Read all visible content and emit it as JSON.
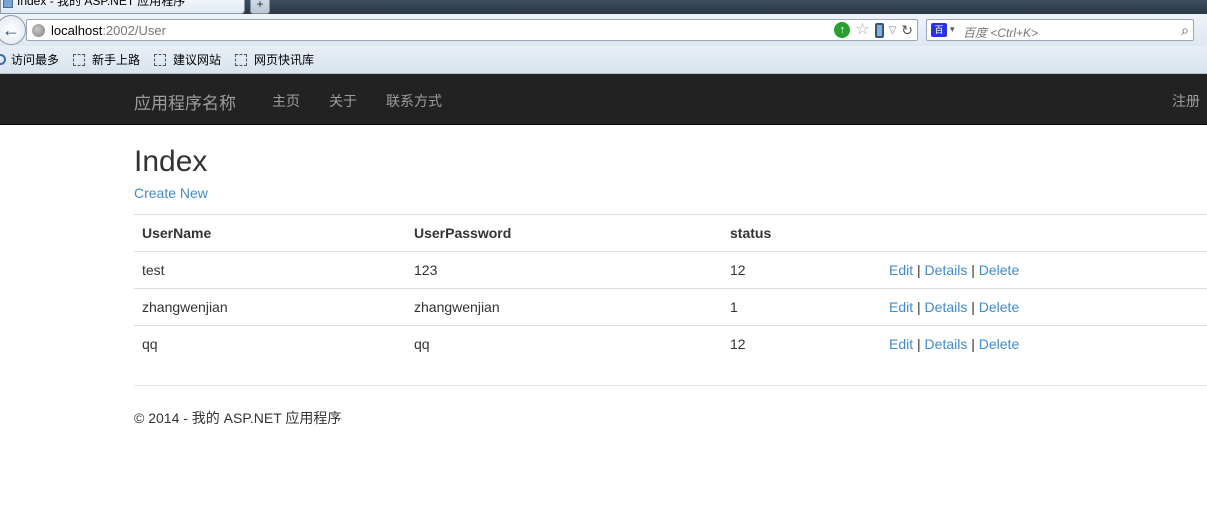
{
  "browser": {
    "tab_title": "Index - 我的 ASP.NET 应用程序",
    "new_tab_label": "+",
    "url_host": "localhost",
    "url_path": ":2002/User",
    "search_placeholder": "百度 <Ctrl+K>",
    "search_engine_label": "百",
    "bookmarks": [
      "访问最多",
      "新手上路",
      "建议网站",
      "网页快讯库"
    ]
  },
  "navbar": {
    "brand": "应用程序名称",
    "links": [
      "主页",
      "关于",
      "联系方式"
    ],
    "register": "注册"
  },
  "main": {
    "title": "Index",
    "create_link": "Create New",
    "table": {
      "headers": [
        "UserName",
        "UserPassword",
        "status"
      ],
      "rows": [
        {
          "username": "test",
          "password": "123",
          "status": "12"
        },
        {
          "username": "zhangwenjian",
          "password": "zhangwenjian",
          "status": "1"
        },
        {
          "username": "qq",
          "password": "qq",
          "status": "12"
        }
      ],
      "actions": {
        "edit": "Edit",
        "details": "Details",
        "delete": "Delete",
        "separator": "|"
      }
    }
  },
  "footer": {
    "text": "© 2014 - 我的 ASP.NET 应用程序"
  },
  "colors": {
    "navbar_bg": "#222222",
    "link": "#428bca",
    "nav_text": "#9d9d9d"
  }
}
